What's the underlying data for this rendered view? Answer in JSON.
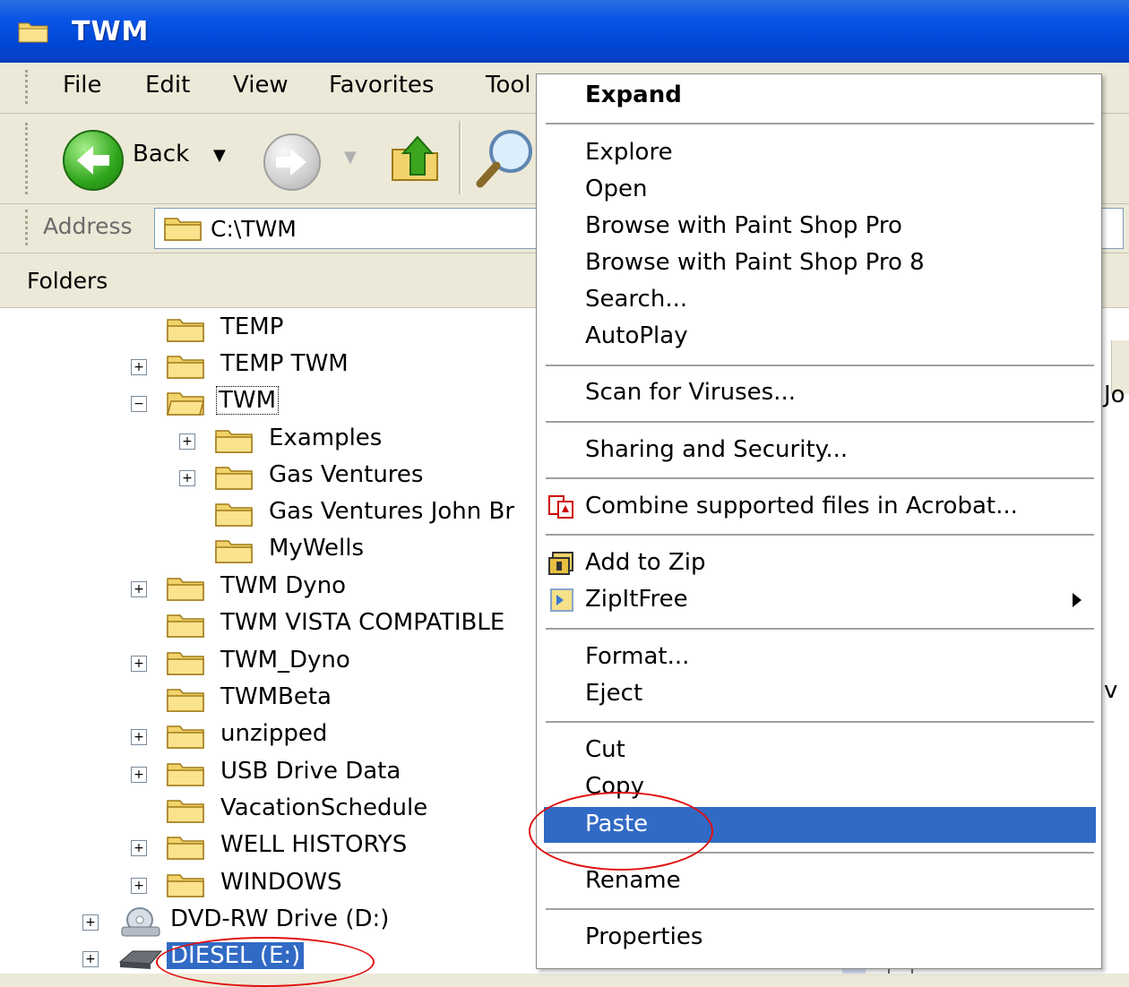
{
  "window": {
    "title": "TWM"
  },
  "menu": {
    "items": [
      "File",
      "Edit",
      "View",
      "Favorites",
      "Tool"
    ]
  },
  "toolbar": {
    "back_label": "Back"
  },
  "address": {
    "label": "Address",
    "path": "C:\\TWM"
  },
  "folders_pane": {
    "title": "Folders"
  },
  "tree": [
    {
      "label": "TEMP",
      "expander": ""
    },
    {
      "label": "TEMP TWM",
      "expander": "+"
    },
    {
      "label": "TWM",
      "expander": "−",
      "state": "focused"
    },
    {
      "label": "Examples",
      "expander": "+"
    },
    {
      "label": "Gas Ventures",
      "expander": "+"
    },
    {
      "label": "Gas Ventures John Br",
      "expander": ""
    },
    {
      "label": "MyWells",
      "expander": ""
    },
    {
      "label": "TWM Dyno",
      "expander": "+"
    },
    {
      "label": "TWM VISTA COMPATIBLE",
      "expander": ""
    },
    {
      "label": "TWM_Dyno",
      "expander": "+"
    },
    {
      "label": "TWMBeta",
      "expander": ""
    },
    {
      "label": "unzipped",
      "expander": "+"
    },
    {
      "label": "USB Drive Data",
      "expander": "+"
    },
    {
      "label": "VacationSchedule",
      "expander": ""
    },
    {
      "label": "WELL HISTORYS",
      "expander": "+"
    },
    {
      "label": "WINDOWS",
      "expander": "+"
    },
    {
      "label": "DVD-RW Drive (D:)",
      "expander": "+"
    },
    {
      "label": "DIESEL (E:)",
      "expander": "+",
      "state": "selected"
    }
  ],
  "context_menu": {
    "expand": "Expand",
    "explore": "Explore",
    "open": "Open",
    "browse_psp": "Browse with Paint Shop Pro",
    "browse_psp8": "Browse with Paint Shop Pro 8",
    "search": "Search...",
    "autoplay": "AutoPlay",
    "scan": "Scan for Viruses...",
    "sharing": "Sharing and Security...",
    "combine": "Combine supported files in Acrobat...",
    "add_zip": "Add to Zip",
    "zipitfree": "ZipItFree",
    "format": "Format...",
    "eject": "Eject",
    "cut": "Cut",
    "copy": "Copy",
    "paste": "Paste",
    "rename": "Rename",
    "properties": "Properties",
    "highlighted": "Paste"
  },
  "right_pane": {
    "fragment_1": "Jo",
    "fragment_2": "v"
  },
  "colors": {
    "highlight": "#316ac5",
    "annotation": "#e01010",
    "titlebar": "#0a55e6"
  }
}
